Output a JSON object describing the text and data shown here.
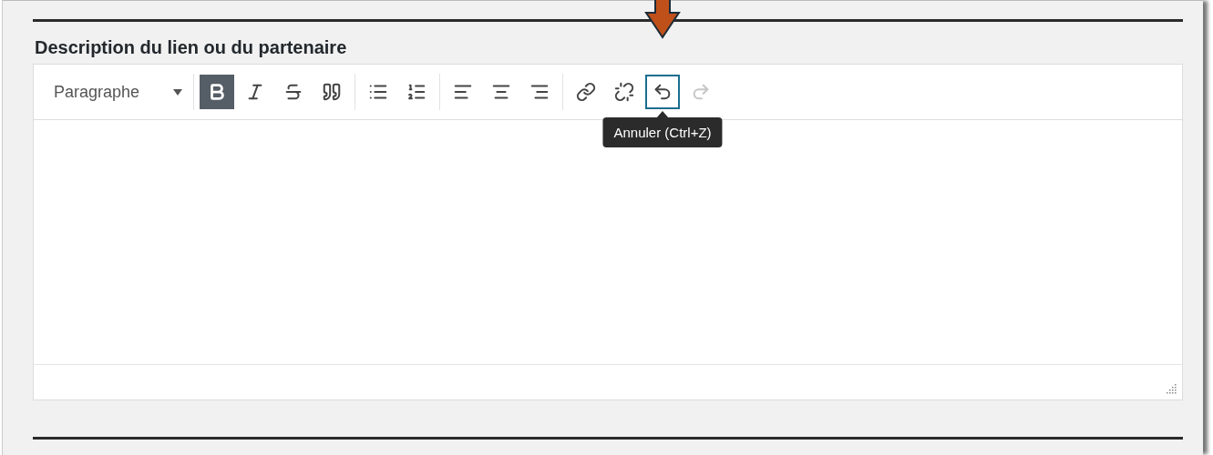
{
  "field": {
    "label": "Description du lien ou du partenaire"
  },
  "toolbar": {
    "format_select": {
      "value": "Paragraphe"
    },
    "groups": [
      [
        {
          "kind": "bold",
          "active": true,
          "highlighted": false,
          "disabled": false
        },
        {
          "kind": "italic",
          "active": false,
          "highlighted": false,
          "disabled": false
        },
        {
          "kind": "strikethrough",
          "active": false,
          "highlighted": false,
          "disabled": false
        },
        {
          "kind": "quote",
          "active": false,
          "highlighted": false,
          "disabled": false
        }
      ],
      [
        {
          "kind": "bullet-list",
          "active": false,
          "highlighted": false,
          "disabled": false
        },
        {
          "kind": "numbered-list",
          "active": false,
          "highlighted": false,
          "disabled": false
        }
      ],
      [
        {
          "kind": "align-left",
          "active": false,
          "highlighted": false,
          "disabled": false
        },
        {
          "kind": "align-center",
          "active": false,
          "highlighted": false,
          "disabled": false
        },
        {
          "kind": "align-right",
          "active": false,
          "highlighted": false,
          "disabled": false
        }
      ],
      [
        {
          "kind": "link",
          "active": false,
          "highlighted": false,
          "disabled": false
        },
        {
          "kind": "unlink",
          "active": false,
          "highlighted": false,
          "disabled": false
        },
        {
          "kind": "undo",
          "active": false,
          "highlighted": true,
          "disabled": false,
          "tooltip": "Annuler (Ctrl+Z)"
        },
        {
          "kind": "redo",
          "active": false,
          "highlighted": false,
          "disabled": true
        }
      ]
    ]
  }
}
